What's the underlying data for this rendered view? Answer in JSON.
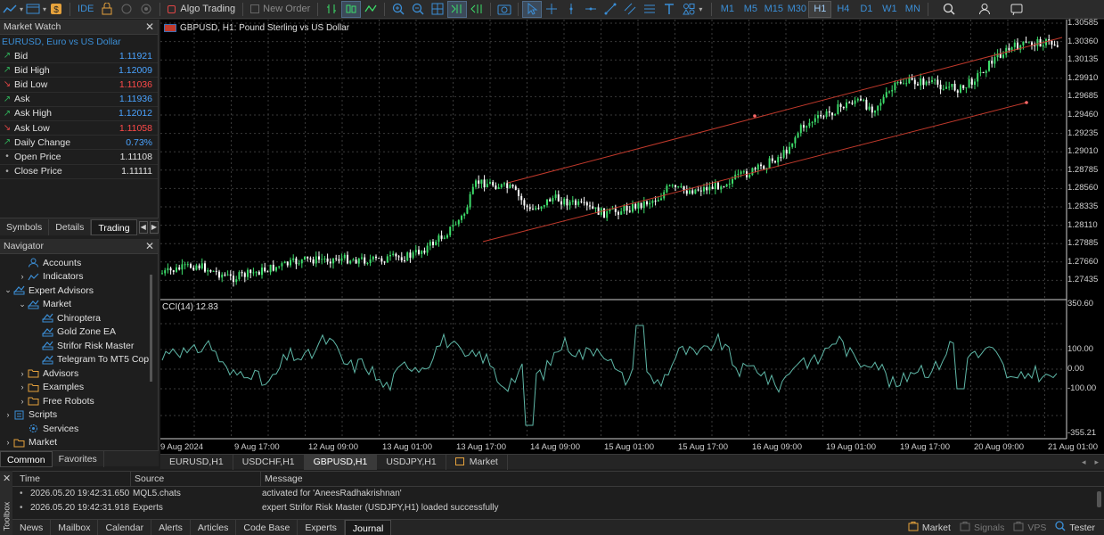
{
  "toolbar": {
    "ide_label": "IDE",
    "algo_trading_label": "Algo Trading",
    "new_order_label": "New Order",
    "timeframes": [
      "M1",
      "M5",
      "M15",
      "M30",
      "H1",
      "H4",
      "D1",
      "W1",
      "MN"
    ],
    "active_timeframe": "H1"
  },
  "market_watch": {
    "title": "Market Watch",
    "symbol": "EURUSD, Euro vs US Dollar",
    "rows": [
      {
        "label": "Bid",
        "value": "1.11921",
        "arrow": "up",
        "color": "blue"
      },
      {
        "label": "Bid High",
        "value": "1.12009",
        "arrow": "up",
        "color": "blue"
      },
      {
        "label": "Bid Low",
        "value": "1.11036",
        "arrow": "down",
        "color": "red"
      },
      {
        "label": "Ask",
        "value": "1.11936",
        "arrow": "up",
        "color": "blue"
      },
      {
        "label": "Ask High",
        "value": "1.12012",
        "arrow": "up",
        "color": "blue"
      },
      {
        "label": "Ask Low",
        "value": "1.11058",
        "arrow": "down",
        "color": "red"
      },
      {
        "label": "Daily Change",
        "value": "0.73%",
        "arrow": "up",
        "color": "blue"
      },
      {
        "label": "Open Price",
        "value": "1.11108",
        "arrow": "dot",
        "color": "white"
      },
      {
        "label": "Close Price",
        "value": "1.11111",
        "arrow": "dot",
        "color": "white"
      }
    ],
    "tabs": [
      "Symbols",
      "Details",
      "Trading"
    ]
  },
  "navigator": {
    "title": "Navigator",
    "items": [
      {
        "label": "Accounts",
        "indent": 1,
        "expander": "",
        "icon": "accounts-icon"
      },
      {
        "label": "Indicators",
        "indent": 1,
        "expander": "›",
        "icon": "indicators-icon"
      },
      {
        "label": "Expert Advisors",
        "indent": 0,
        "expander": "⌄",
        "icon": "experts-icon"
      },
      {
        "label": "Market",
        "indent": 1,
        "expander": "⌄",
        "icon": "experts-icon"
      },
      {
        "label": "Chiroptera",
        "indent": 2,
        "expander": "",
        "icon": "expert-icon"
      },
      {
        "label": "Gold Zone EA",
        "indent": 2,
        "expander": "",
        "icon": "expert-icon"
      },
      {
        "label": "Strifor Risk Master",
        "indent": 2,
        "expander": "",
        "icon": "expert-icon"
      },
      {
        "label": "Telegram To MT5 Cop",
        "indent": 2,
        "expander": "",
        "icon": "expert-icon"
      },
      {
        "label": "Advisors",
        "indent": 1,
        "expander": "›",
        "icon": "folder-icon"
      },
      {
        "label": "Examples",
        "indent": 1,
        "expander": "›",
        "icon": "folder-icon"
      },
      {
        "label": "Free Robots",
        "indent": 1,
        "expander": "›",
        "icon": "folder-icon"
      },
      {
        "label": "Scripts",
        "indent": 0,
        "expander": "›",
        "icon": "scripts-icon"
      },
      {
        "label": "Services",
        "indent": 1,
        "expander": "",
        "icon": "services-icon"
      },
      {
        "label": "Market",
        "indent": 0,
        "expander": "›",
        "icon": "market-icon"
      }
    ],
    "tabs": [
      "Common",
      "Favorites"
    ]
  },
  "chart": {
    "title": "GBPUSD, H1:  Pound Sterling vs US Dollar",
    "indicator_label": "CCI(14) 12.83",
    "price_ticks": [
      "1.30585",
      "1.30360",
      "1.30135",
      "1.29910",
      "1.29685",
      "1.29460",
      "1.29235",
      "1.29010",
      "1.28785",
      "1.28560",
      "1.28335",
      "1.28110",
      "1.27885",
      "1.27660",
      "1.27435"
    ],
    "cci_ticks": [
      "350.60",
      "100.00",
      "0.00",
      "-100.00",
      "-355.21"
    ],
    "time_ticks": [
      "9 Aug 2024",
      "9 Aug 17:00",
      "12 Aug 09:00",
      "13 Aug 01:00",
      "13 Aug 17:00",
      "14 Aug 09:00",
      "15 Aug 01:00",
      "15 Aug 17:00",
      "16 Aug 09:00",
      "19 Aug 01:00",
      "19 Aug 17:00",
      "20 Aug 09:00",
      "21 Aug 01:00"
    ],
    "colors": {
      "bull": "#3ddc6a",
      "bear": "#ffffff",
      "channel": "#c0392b",
      "cci": "#5fb8a8",
      "grid": "#3a3a3a"
    }
  },
  "chart_tabs": [
    "EURUSD,H1",
    "USDCHF,H1",
    "GBPUSD,H1",
    "USDJPY,H1",
    "Market"
  ],
  "active_chart_tab": "GBPUSD,H1",
  "journal": {
    "headers": {
      "time": "Time",
      "source": "Source",
      "message": "Message"
    },
    "rows": [
      {
        "time": "2026.05.20 19:42:31.650",
        "source": "MQL5.chats",
        "message": "activated for 'AneesRadhakrishnan'"
      },
      {
        "time": "2026.05.20 19:42:31.918",
        "source": "Experts",
        "message": "expert Strifor Risk Master (USDJPY,H1) loaded successfully"
      }
    ],
    "toolbox_label": "Toolbox",
    "tabs": [
      "News",
      "Mailbox",
      "Calendar",
      "Alerts",
      "Articles",
      "Code Base",
      "Experts",
      "Journal"
    ],
    "active_tab": "Journal",
    "status": [
      "Market",
      "Signals",
      "VPS",
      "Tester"
    ]
  }
}
